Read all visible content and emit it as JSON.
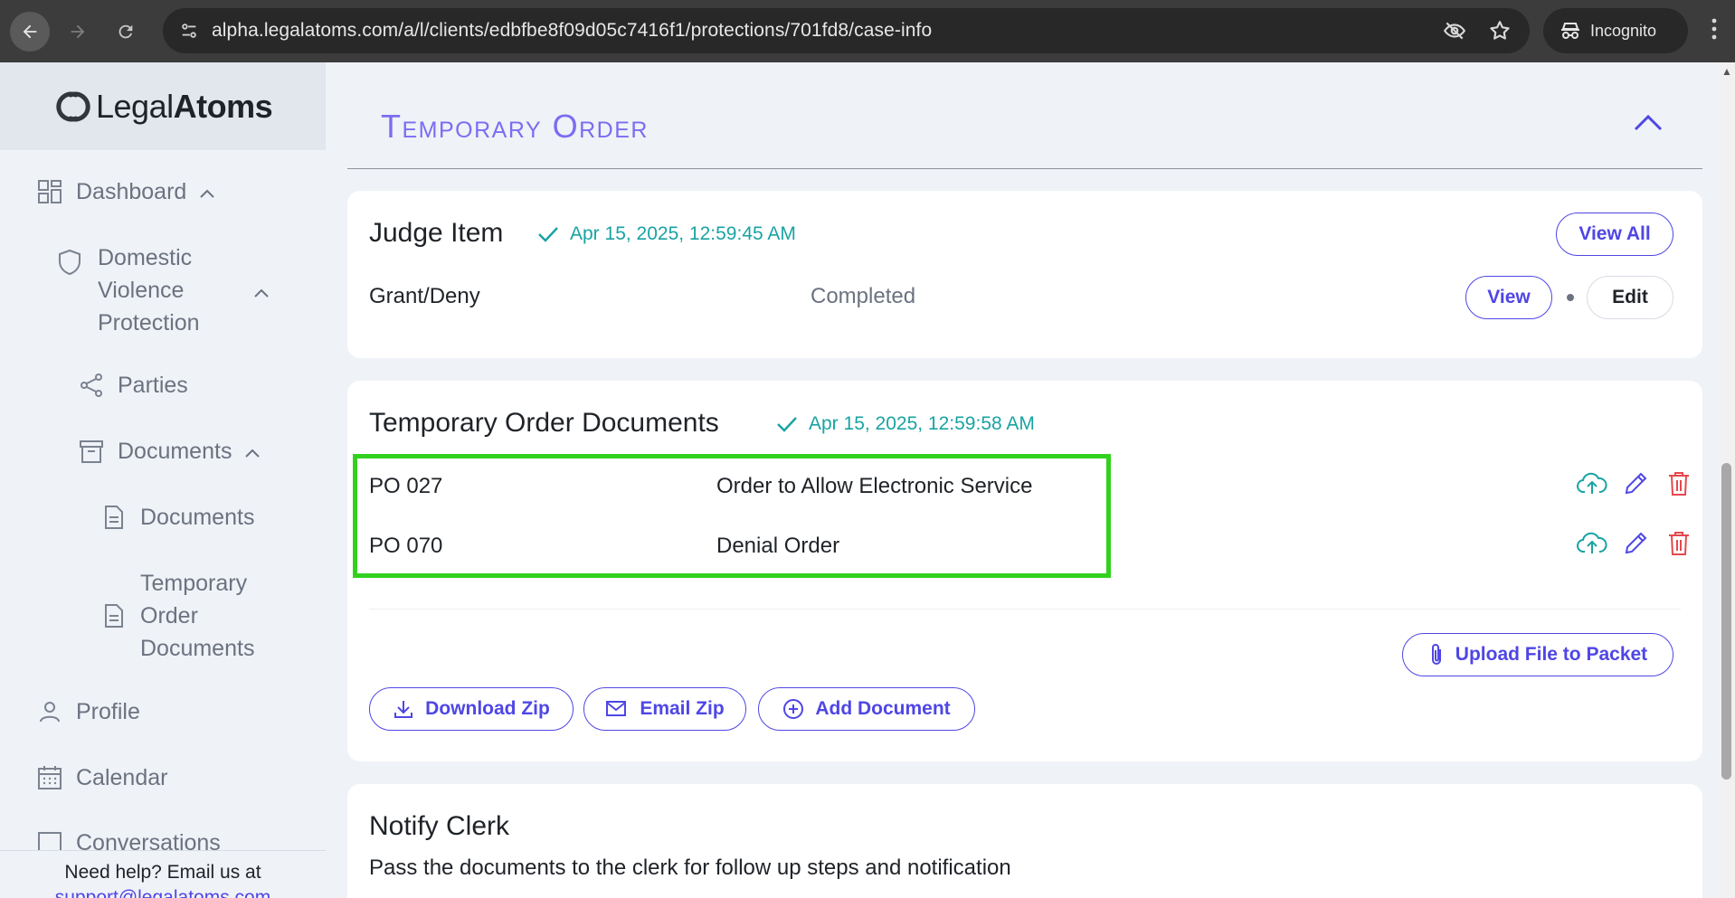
{
  "browser": {
    "url": "alpha.legalatoms.com/a/l/clients/edbfbe8f09d05c7416f1/protections/701fd8/case-info",
    "incognito_label": "Incognito"
  },
  "sidebar": {
    "logo_light": "Legal",
    "logo_bold": "Atoms",
    "dashboard": "Dashboard",
    "dv_line1": "Domestic",
    "dv_line2": "Violence",
    "dv_line3": "Protection",
    "parties": "Parties",
    "documents": "Documents",
    "documents_sub": "Documents",
    "temp_line1": "Temporary",
    "temp_line2": "Order",
    "temp_line3": "Documents",
    "profile": "Profile",
    "calendar": "Calendar",
    "conversations": "Conversations",
    "help_text": "Need help? Email us at",
    "help_email": "support@legalatoms.com"
  },
  "section": {
    "title": "Temporary Order"
  },
  "judge_card": {
    "title": "Judge Item",
    "timestamp": "Apr 15, 2025, 12:59:45 AM",
    "view_all": "View All",
    "row_label": "Grant/Deny",
    "row_status": "Completed",
    "view": "View",
    "edit": "Edit"
  },
  "docs_card": {
    "title": "Temporary Order Documents",
    "timestamp": "Apr 15, 2025, 12:59:58 AM",
    "rows": [
      {
        "code": "PO 027",
        "name": "Order to Allow Electronic Service"
      },
      {
        "code": "PO 070",
        "name": "Denial Order"
      }
    ],
    "upload_packet": "Upload File to Packet",
    "download_zip": "Download Zip",
    "email_zip": "Email Zip",
    "add_document": "Add Document"
  },
  "notify_card": {
    "title": "Notify Clerk",
    "description": "Pass the documents to the clerk for follow up steps and notification"
  },
  "colors": {
    "accent": "#4f46e5",
    "title_purple": "#7c6cf2",
    "teal": "#1aa3a3",
    "danger": "#e5484d",
    "highlight": "#33d11f"
  }
}
